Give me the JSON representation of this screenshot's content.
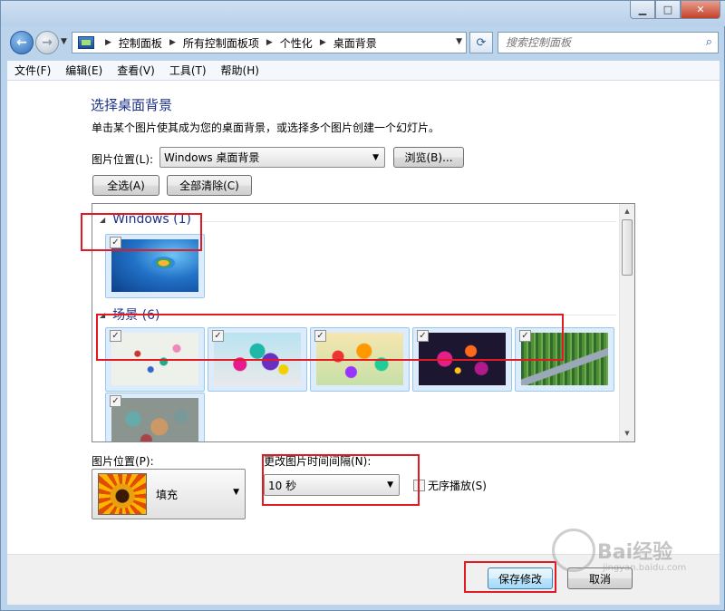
{
  "window": {
    "caption_buttons": {
      "minimize": "▁",
      "maximize": "□",
      "close": "✕"
    }
  },
  "nav": {
    "back_icon": "arrow-left-icon",
    "forward_icon": "arrow-right-icon",
    "back_glyph": "←",
    "forward_glyph": "→",
    "breadcrumb": [
      "控制面板",
      "所有控制面板项",
      "个性化",
      "桌面背景"
    ],
    "refresh_glyph": "⟳",
    "search_placeholder": "搜索控制面板",
    "search_glyph": "⌕"
  },
  "menu": [
    "文件(F)",
    "编辑(E)",
    "查看(V)",
    "工具(T)",
    "帮助(H)"
  ],
  "page": {
    "title": "选择桌面背景",
    "description": "单击某个图片使其成为您的桌面背景，或选择多个图片创建一个幻灯片。",
    "location_label": "图片位置(L):",
    "location_value": "Windows 桌面背景",
    "browse_button": "浏览(B)...",
    "select_all_button": "全选(A)",
    "clear_all_button": "全部清除(C)"
  },
  "gallery": {
    "groups": [
      {
        "name": "Windows (1)",
        "items": [
          {
            "checked": true,
            "theme": "windows7-logo"
          }
        ]
      },
      {
        "name": "场景 (6)",
        "items": [
          {
            "checked": true,
            "theme": "abstract-flowers"
          },
          {
            "checked": true,
            "theme": "colorful-castle"
          },
          {
            "checked": true,
            "theme": "fantasy-garden"
          },
          {
            "checked": true,
            "theme": "dark-bubbles"
          },
          {
            "checked": true,
            "theme": "forest-path"
          },
          {
            "checked": true,
            "theme": "abstract-shapes"
          }
        ]
      }
    ],
    "check_glyph": "✓"
  },
  "position": {
    "label": "图片位置(P):",
    "value": "填充"
  },
  "interval": {
    "label": "更改图片时间间隔(N):",
    "value": "10 秒"
  },
  "shuffle": {
    "label": "无序播放(S)",
    "checked": false
  },
  "footer": {
    "save_button": "保存修改",
    "cancel_button": "取消"
  },
  "watermark": {
    "text": "Bai经验",
    "sub": "jingyan.baidu.com"
  },
  "colors": {
    "accent": "#1e3287",
    "highlight": "#e01b24"
  }
}
